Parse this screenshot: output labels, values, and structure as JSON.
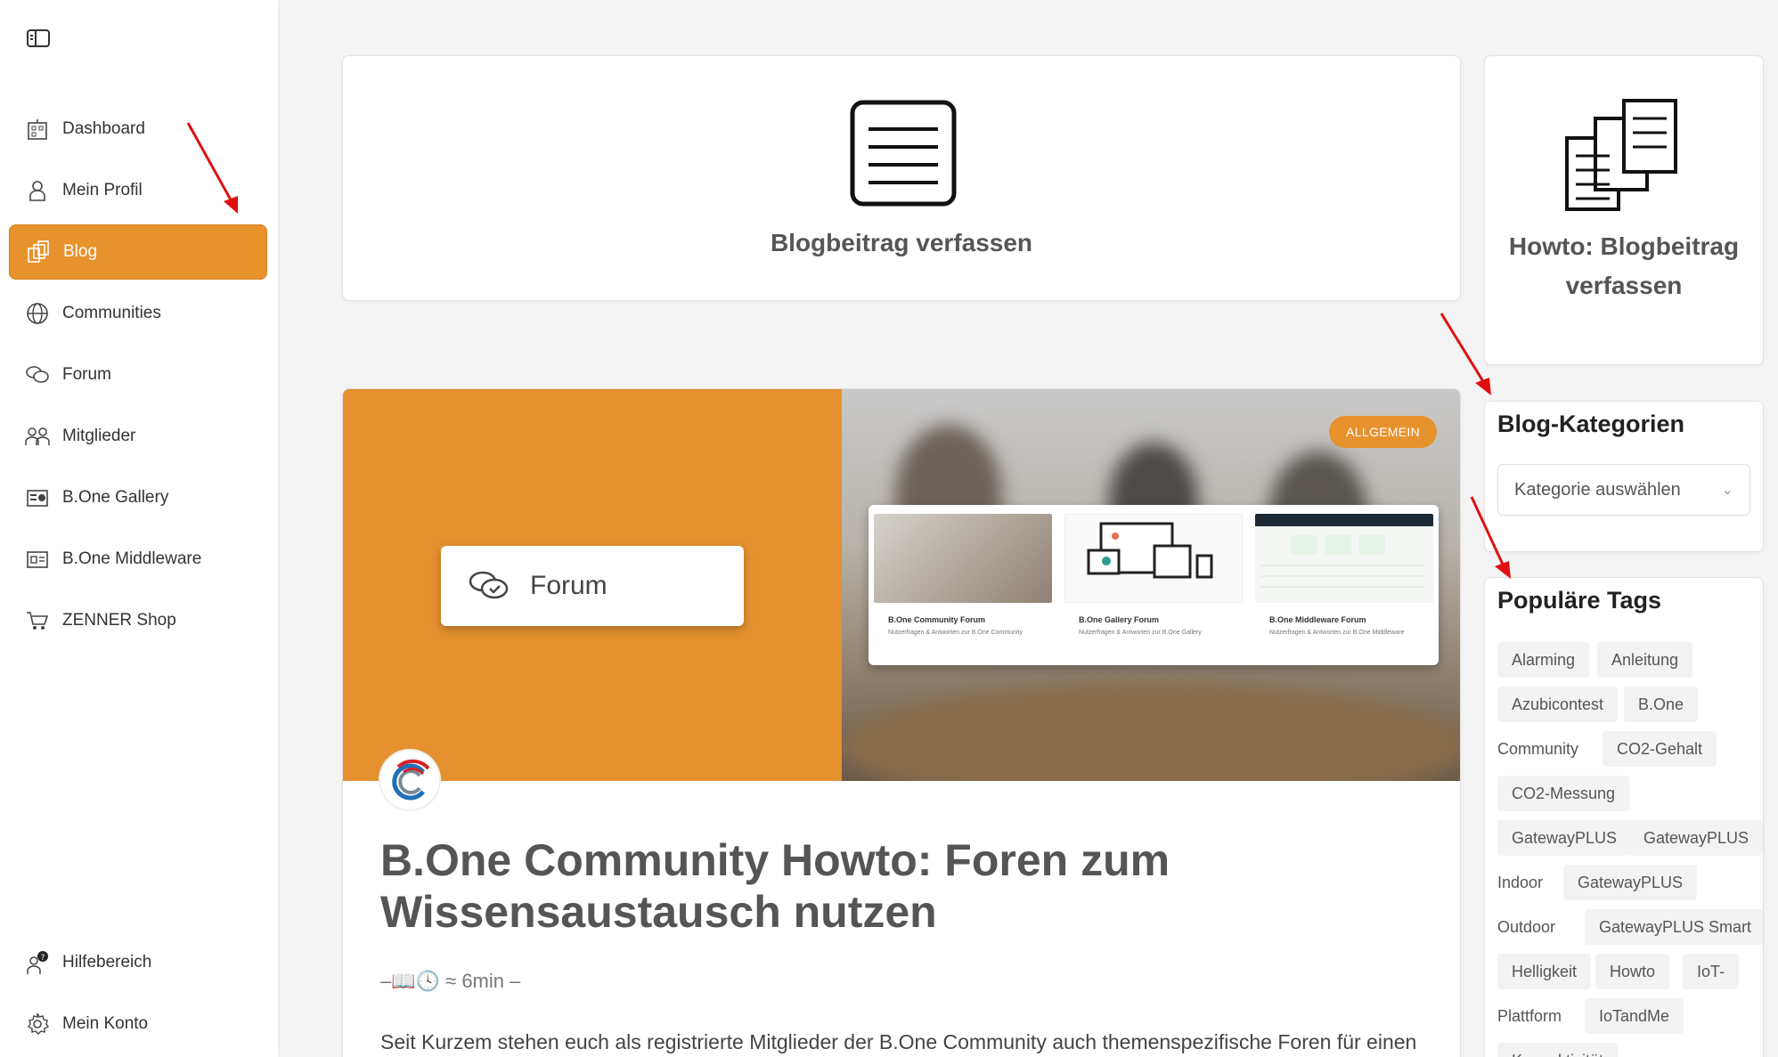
{
  "sidebar": {
    "items": [
      {
        "label": "Dashboard",
        "icon": "dashboard-icon"
      },
      {
        "label": "Mein Profil",
        "icon": "user-icon"
      },
      {
        "label": "Blog",
        "icon": "blog-icon",
        "active": true
      },
      {
        "label": "Communities",
        "icon": "globe-icon"
      },
      {
        "label": "Forum",
        "icon": "chat-icon"
      },
      {
        "label": "Mitglieder",
        "icon": "members-icon"
      },
      {
        "label": "B.One Gallery",
        "icon": "gallery-icon"
      },
      {
        "label": "B.One Middleware",
        "icon": "middleware-icon"
      },
      {
        "label": "ZENNER Shop",
        "icon": "cart-icon"
      }
    ],
    "bottom": [
      {
        "label": "Hilfebereich",
        "icon": "help-icon"
      },
      {
        "label": "Mein Konto",
        "icon": "gear-icon"
      }
    ]
  },
  "compose": {
    "title": "Blogbeitrag verfassen"
  },
  "howto": {
    "title": "Howto: Blogbeitrag verfassen"
  },
  "categories": {
    "title": "Blog-Kategorien",
    "select_value": "Kategorie auswählen"
  },
  "tags": {
    "title": "Populäre Tags",
    "items": [
      "Alarming",
      "Anleitung",
      "Azubicontest",
      "B.One",
      "Community",
      "CO2-Gehalt",
      "CO2-Messung",
      "GatewayPLUS",
      "GatewayPLUS",
      "Indoor",
      "GatewayPLUS",
      "Outdoor",
      "GatewayPLUS Smart",
      "Helligkeit",
      "Howto",
      "IoT-",
      "Plattform",
      "IoTandMe",
      "Konnektivität"
    ]
  },
  "post": {
    "badge": "ALLGEMEIN",
    "forum_button": "Forum",
    "screens": [
      {
        "title": "B.One Community Forum",
        "sub": "Nutzerfragen & Antworten zur B.One Community"
      },
      {
        "title": "B.One Gallery Forum",
        "sub": "Nutzerfragen & Antworten zur B.One Gallery"
      },
      {
        "title": "B.One Middleware Forum",
        "sub": "Nutzerfragen & Antworten zur B.One Middleware"
      }
    ],
    "title": "B.One Community Howto: Foren zum Wissensaustausch nutzen",
    "meta": "–📖🕓 ≈ 6min –",
    "excerpt": "Seit Kurzem stehen euch als registrierte Mitglieder der B.One Community auch themenspezifische Foren für einen"
  },
  "colors": {
    "accent": "#e8922d",
    "annotation_arrow": "#e01010"
  }
}
